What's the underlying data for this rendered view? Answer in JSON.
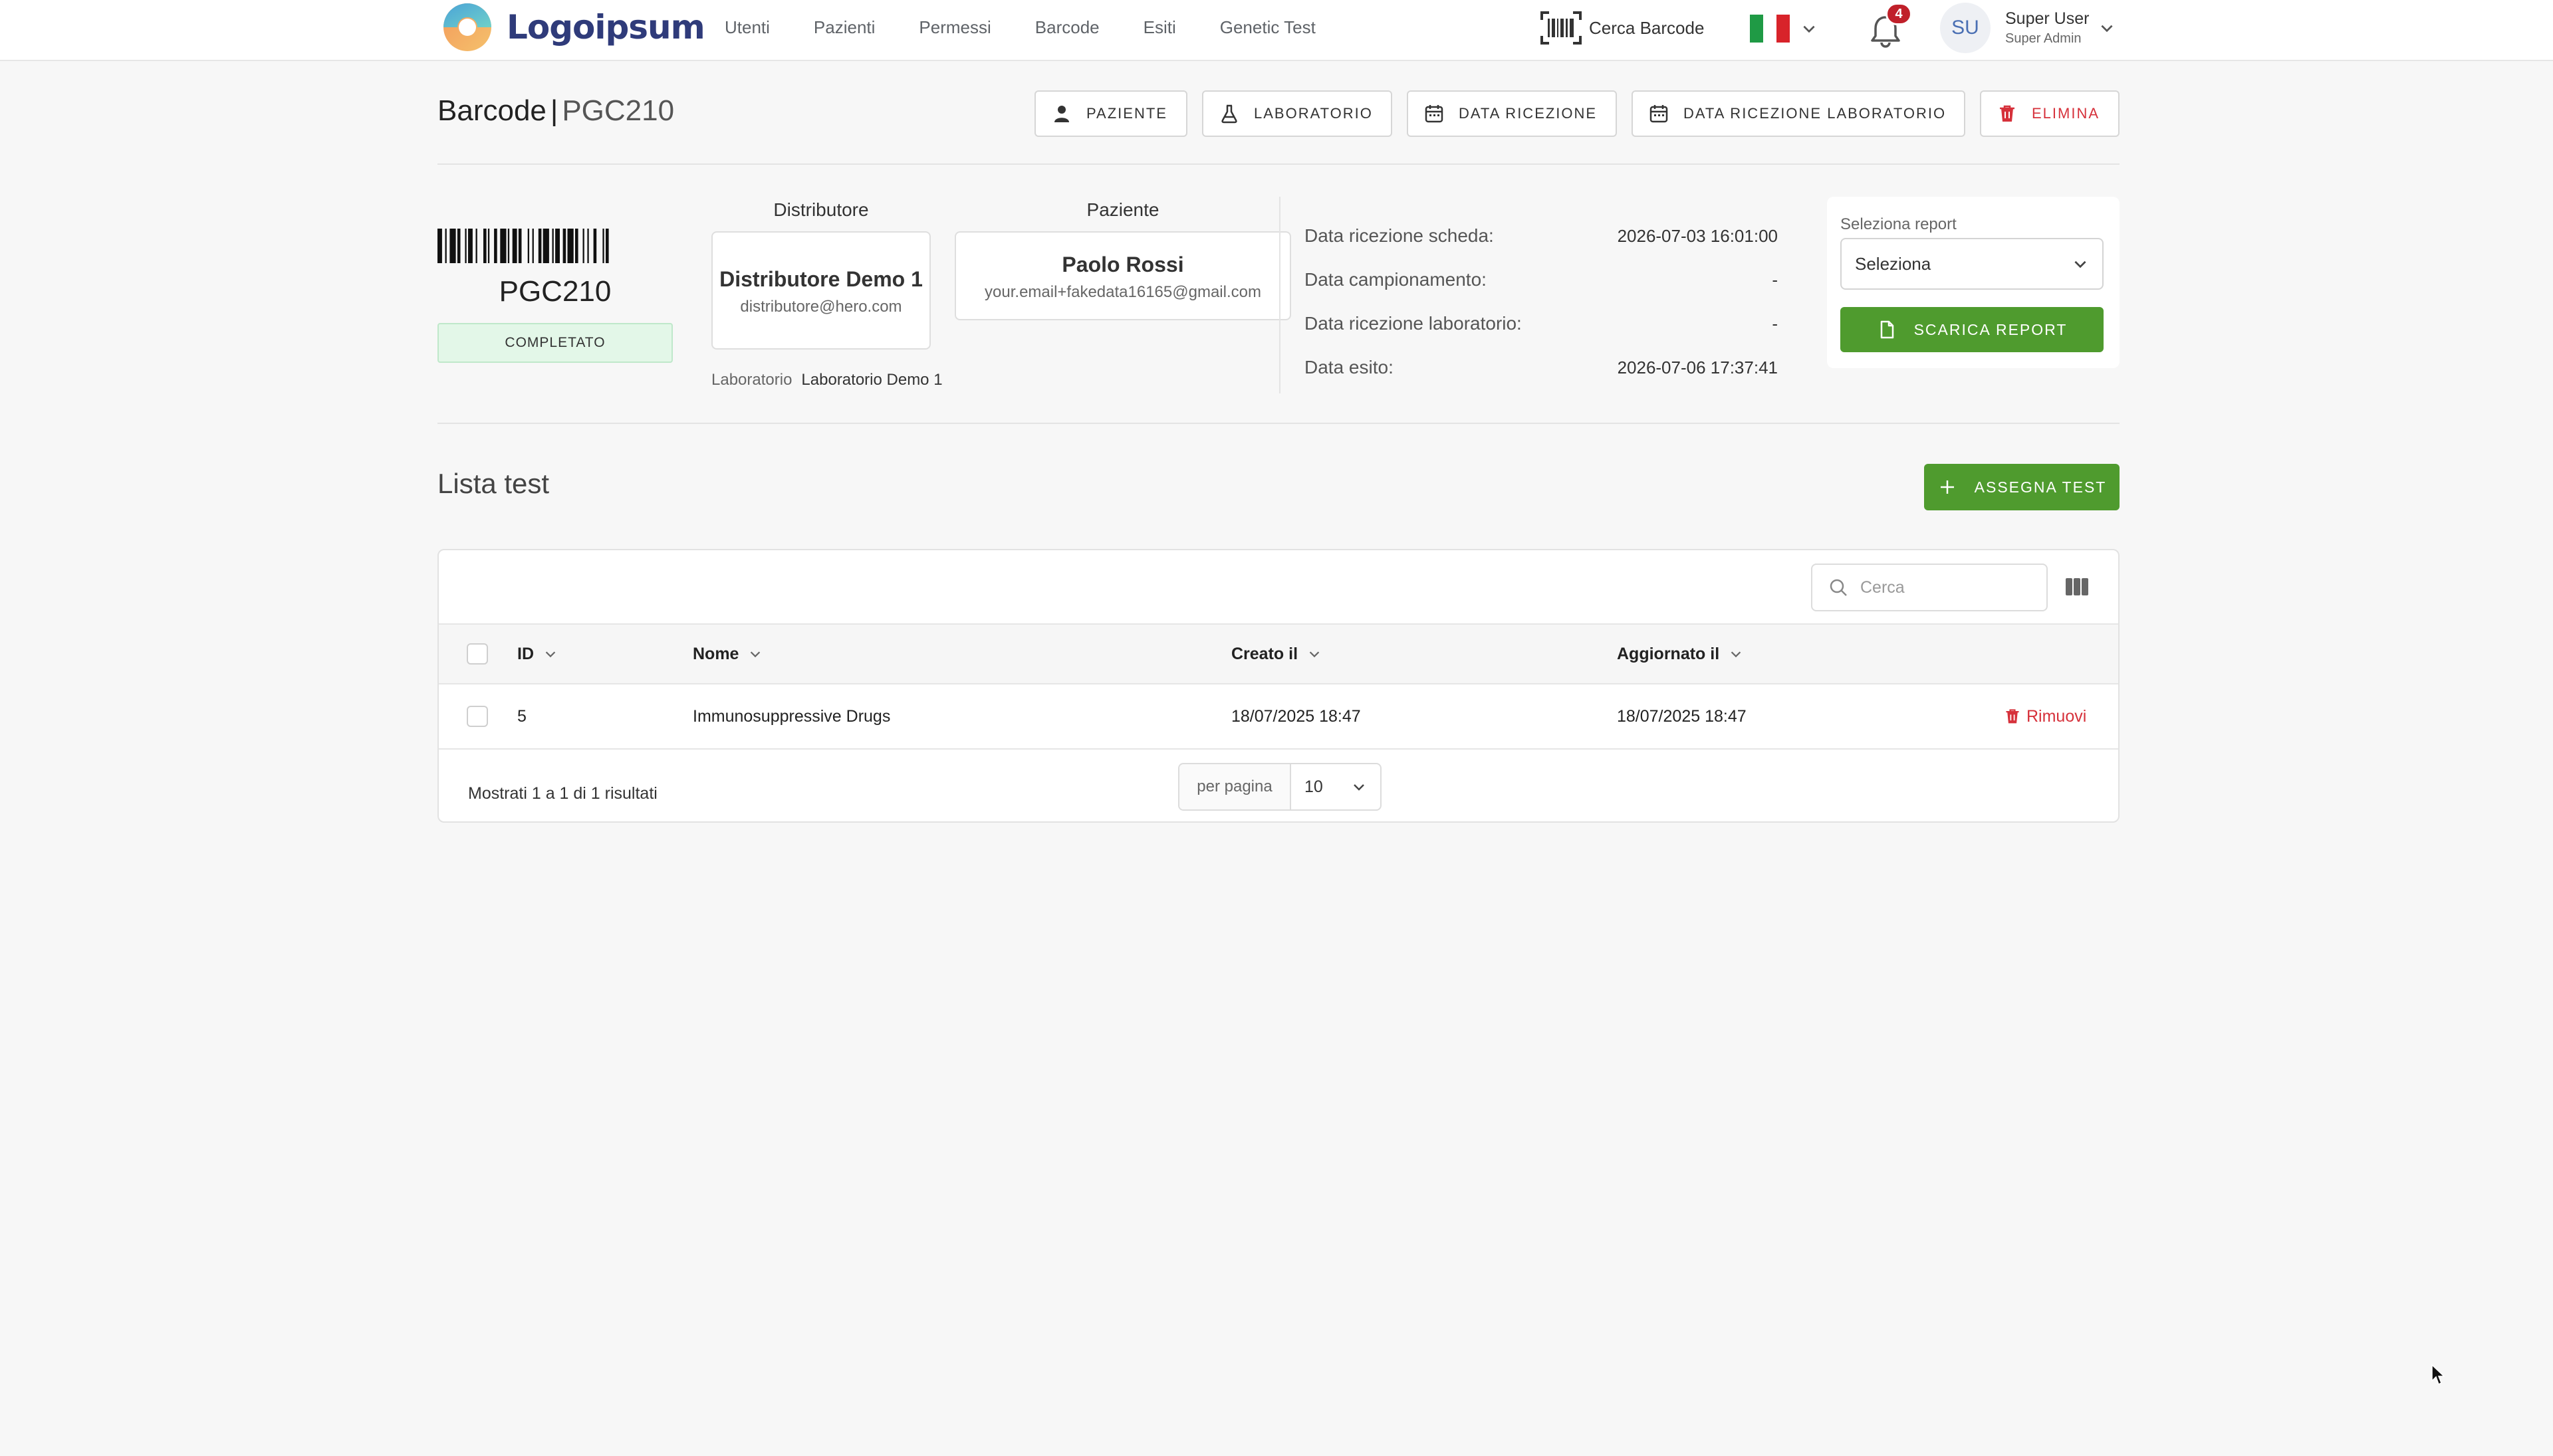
{
  "topnav": {
    "logo_text": "Logoipsum",
    "menu": [
      "Utenti",
      "Pazienti",
      "Permessi",
      "Barcode",
      "Esiti",
      "Genetic Test"
    ],
    "barcode_search_label": "Cerca Barcode",
    "language": "it",
    "notifications_count": "4",
    "user": {
      "initials": "SU",
      "name": "Super User",
      "role": "Super Admin"
    }
  },
  "header": {
    "title": "Barcode",
    "separator": "|",
    "code": "PGC210",
    "actions": {
      "paziente": "PAZIENTE",
      "laboratorio": "LABORATORIO",
      "data_ricezione": "DATA RICEZIONE",
      "data_ricezione_lab": "DATA RICEZIONE LABORATORIO",
      "elimina": "ELIMINA"
    }
  },
  "summary": {
    "barcode": "PGC210",
    "status": "COMPLETATO",
    "distributore": {
      "heading": "Distributore",
      "name": "Distributore Demo 1",
      "email": "distributore@hero.com"
    },
    "paziente": {
      "heading": "Paziente",
      "name": "Paolo Rossi",
      "email": "your.email+fakedata16165@gmail.com"
    },
    "laboratorio": {
      "label": "Laboratorio",
      "value": "Laboratorio Demo 1"
    },
    "dates": [
      {
        "label": "Data ricezione scheda:",
        "value": "2026-07-03 16:01:00"
      },
      {
        "label": "Data campionamento:",
        "value": "-"
      },
      {
        "label": "Data ricezione laboratorio:",
        "value": "-"
      },
      {
        "label": "Data esito:",
        "value": "2026-07-06 17:37:41"
      }
    ],
    "report": {
      "label": "Seleziona report",
      "selected": "Seleziona",
      "download_label": "SCARICA REPORT"
    }
  },
  "tests": {
    "title": "Lista test",
    "assign_label": "ASSEGNA TEST",
    "search_placeholder": "Cerca",
    "columns": {
      "id": "ID",
      "nome": "Nome",
      "creato": "Creato il",
      "aggiornato": "Aggiornato il"
    },
    "rows": [
      {
        "id": "5",
        "nome": "Immunosuppressive Drugs",
        "creato": "18/07/2025 18:47",
        "aggiornato": "18/07/2025 18:47",
        "action": "Rimuovi"
      }
    ],
    "footer_text": "Mostrati 1 a 1 di 1 risultati",
    "per_page_label": "per pagina",
    "per_page_value": "10"
  },
  "colors": {
    "accent_green": "#4f9b2e",
    "danger_red": "#d6313b",
    "status_bg": "#e3f7e8",
    "nav_text": "#5f6368"
  }
}
